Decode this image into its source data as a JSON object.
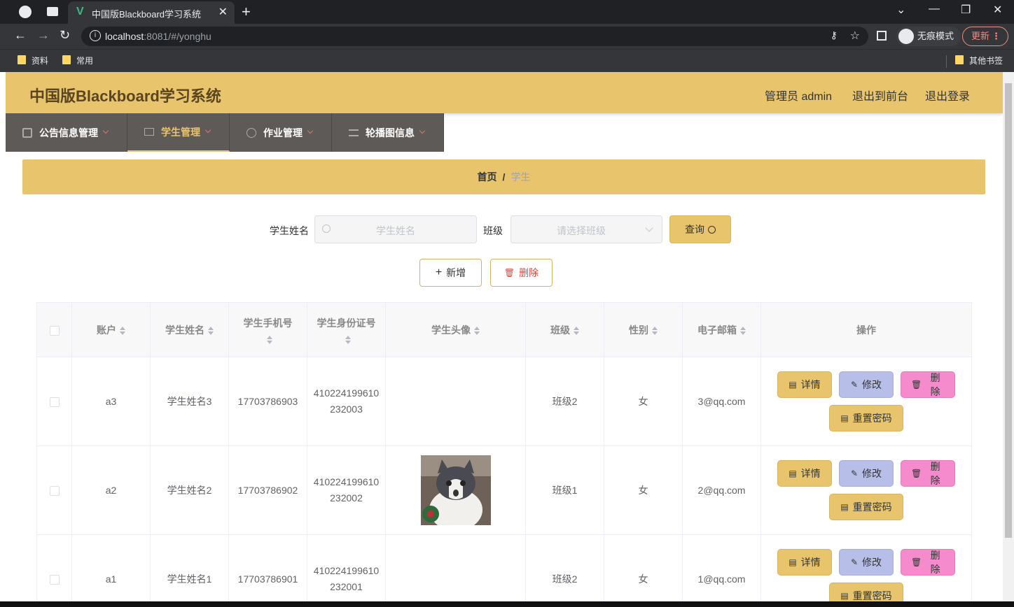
{
  "browser": {
    "tab_title": "中国版Blackboard学习系统",
    "url_host": "localhost",
    "url_rest": ":8081/#/yonghu",
    "incognito_label": "无痕模式",
    "update_label": "更新",
    "bookmarks": [
      "资料",
      "常用"
    ],
    "other_bookmarks": "其他书签"
  },
  "header": {
    "title": "中国版Blackboard学习系统",
    "admin": "管理员 admin",
    "to_front": "退出到前台",
    "logout": "退出登录"
  },
  "menu": {
    "items": [
      {
        "label": "公告信息管理",
        "icon": "clipboard-icon"
      },
      {
        "label": "学生管理",
        "icon": "mail-icon"
      },
      {
        "label": "作业管理",
        "icon": "compass-icon"
      },
      {
        "label": "轮播图信息",
        "icon": "list-icon"
      }
    ],
    "active_index": 1
  },
  "breadcrumb": {
    "home": "首页",
    "sep": "/",
    "current": "学生"
  },
  "search": {
    "name_label": "学生姓名",
    "name_placeholder": "学生姓名",
    "class_label": "班级",
    "class_placeholder": "请选择班级",
    "query_label": "查询"
  },
  "actions": {
    "add_label": "新增",
    "delete_label": "删除"
  },
  "table": {
    "columns": [
      "账户",
      "学生姓名",
      "学生手机号",
      "学生身份证号",
      "学生头像",
      "班级",
      "性别",
      "电子邮箱",
      "操作"
    ],
    "rows": [
      {
        "account": "a3",
        "name": "学生姓名3",
        "phone": "17703786903",
        "id_no": "410224199610232003",
        "has_avatar": false,
        "class": "班级2",
        "gender": "女",
        "email": "3@qq.com"
      },
      {
        "account": "a2",
        "name": "学生姓名2",
        "phone": "17703786902",
        "id_no": "410224199610232002",
        "has_avatar": true,
        "class": "班级1",
        "gender": "女",
        "email": "2@qq.com"
      },
      {
        "account": "a1",
        "name": "学生姓名1",
        "phone": "17703786901",
        "id_no": "410224199610232001",
        "has_avatar": false,
        "class": "班级2",
        "gender": "女",
        "email": "1@qq.com"
      }
    ],
    "op_labels": {
      "detail": "详情",
      "edit": "修改",
      "remove": "删除",
      "reset": "重置密码"
    }
  },
  "colors": {
    "accent": "#e8c56d",
    "menu_bg": "#5e5a57",
    "edit": "#b7bfe8",
    "remove": "#f58bcd"
  }
}
